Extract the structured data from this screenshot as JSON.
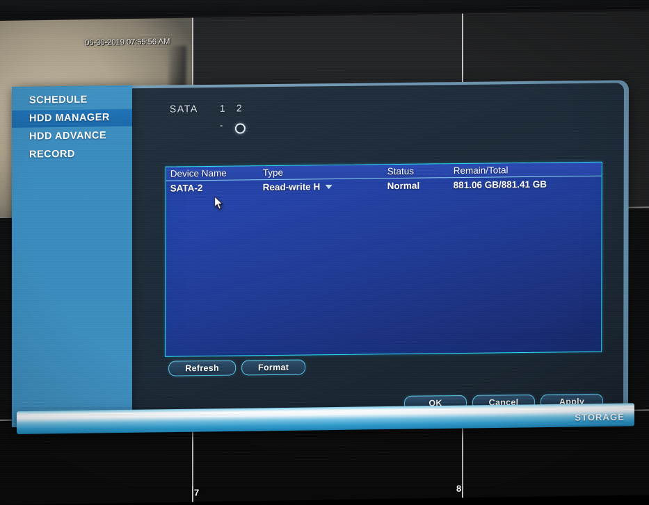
{
  "osd": {
    "timestamp": "06-30-2019 07:55:56 AM",
    "channel_labels": [
      "7",
      "8"
    ]
  },
  "sidebar": {
    "items": [
      {
        "label": "SCHEDULE",
        "selected": false
      },
      {
        "label": "HDD MANAGER",
        "selected": true
      },
      {
        "label": "HDD ADVANCE",
        "selected": false
      },
      {
        "label": "RECORD",
        "selected": false
      }
    ]
  },
  "sata": {
    "label": "SATA",
    "ports": [
      "1",
      "2"
    ],
    "states": [
      "-",
      "O"
    ]
  },
  "table": {
    "columns": [
      "Device Name",
      "Type",
      "Status",
      "Remain/Total"
    ],
    "rows": [
      {
        "device_name": "SATA-2",
        "type": "Read-write H",
        "status": "Normal",
        "remain_total": "881.06 GB/881.41 GB"
      }
    ]
  },
  "actions": {
    "refresh": "Refresh",
    "format": "Format",
    "ok": "OK",
    "cancel": "Cancel",
    "apply": "Apply"
  },
  "status_bar": {
    "title": "STORAGE"
  },
  "colors": {
    "accent_cyan": "#2ee0ff",
    "sidebar_blue": "#3a8cbe",
    "selected_blue": "#1e74b8",
    "table_blue": "#2443aa",
    "status_bar": "#72c3e6"
  }
}
